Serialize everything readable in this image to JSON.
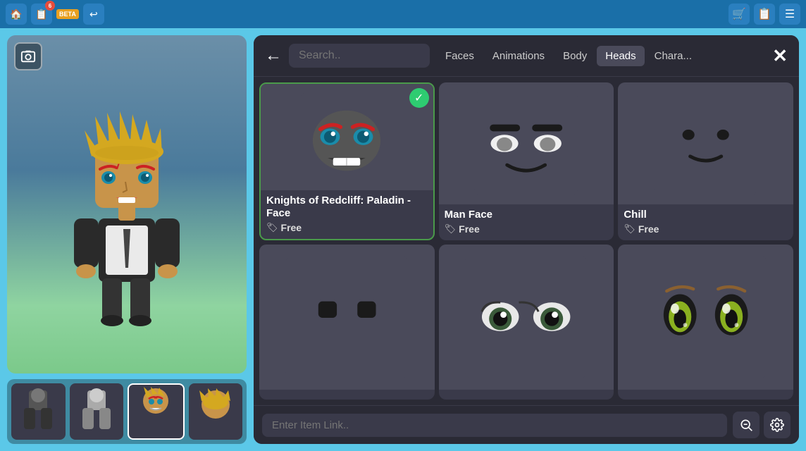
{
  "topbar": {
    "notification_count": "6",
    "beta_label": "BETA"
  },
  "left_panel": {
    "preview_icon": "📷",
    "outfit_thumbs": [
      {
        "label": "thumb1"
      },
      {
        "label": "thumb2"
      },
      {
        "label": "thumb3"
      },
      {
        "label": "thumb4"
      }
    ]
  },
  "shop": {
    "search_placeholder": "Search..",
    "tabs": [
      {
        "label": "Faces",
        "active": false
      },
      {
        "label": "Animations",
        "active": false
      },
      {
        "label": "Body",
        "active": false
      },
      {
        "label": "Heads",
        "active": true
      },
      {
        "label": "Chara...",
        "active": false
      }
    ],
    "items": [
      {
        "name": "Knights of Redcliff: Paladin - Face",
        "price": "Free",
        "selected": true
      },
      {
        "name": "Man Face",
        "price": "Free",
        "selected": false
      },
      {
        "name": "Chill",
        "price": "Free",
        "selected": false
      },
      {
        "name": "",
        "price": "",
        "selected": false
      },
      {
        "name": "",
        "price": "",
        "selected": false
      },
      {
        "name": "",
        "price": "",
        "selected": false
      }
    ],
    "item_link_placeholder": "Enter Item Link..",
    "zoom_icon": "🔍",
    "settings_icon": "⚙"
  }
}
